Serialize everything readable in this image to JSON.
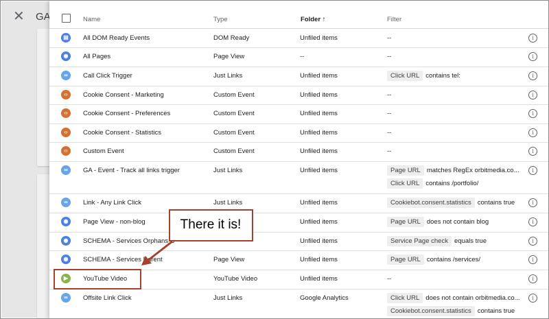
{
  "background": {
    "close_glyph": "✕",
    "title_fragment": "GA"
  },
  "table": {
    "headers": {
      "name": "Name",
      "type": "Type",
      "folder": "Folder",
      "sort_glyph": "↑",
      "filter": "Filter"
    },
    "info_glyph": "i",
    "rows": [
      {
        "name": "All DOM Ready Events",
        "type": "DOM Ready",
        "folder": "Unfiled items",
        "icon": "dom-ready-icon",
        "color": "#4a80e6",
        "glyph": "▤",
        "filters": [],
        "filter_text": "--"
      },
      {
        "name": "All Pages",
        "type": "Page View",
        "folder": "--",
        "icon": "eye-icon",
        "color": "#4a80e6",
        "glyph": "◉",
        "filters": [],
        "filter_text": "--"
      },
      {
        "name": "Call Click Trigger",
        "type": "Just Links",
        "folder": "Unfiled items",
        "icon": "link-icon",
        "color": "#66a5e8",
        "glyph": "∞",
        "filters": [
          {
            "chip": "Click URL",
            "rest": "contains tel:"
          }
        ]
      },
      {
        "name": "Cookie Consent - Marketing",
        "type": "Custom Event",
        "folder": "Unfiled items",
        "icon": "custom-event-icon",
        "color": "#d67131",
        "glyph": "‹›",
        "filters": [],
        "filter_text": "--"
      },
      {
        "name": "Cookie Consent - Preferences",
        "type": "Custom Event",
        "folder": "Unfiled items",
        "icon": "custom-event-icon",
        "color": "#d67131",
        "glyph": "‹›",
        "filters": [],
        "filter_text": "--"
      },
      {
        "name": "Cookie Consent - Statistics",
        "type": "Custom Event",
        "folder": "Unfiled items",
        "icon": "custom-event-icon",
        "color": "#d67131",
        "glyph": "‹›",
        "filters": [],
        "filter_text": "--"
      },
      {
        "name": "Custom Event",
        "type": "Custom Event",
        "folder": "Unfiled items",
        "icon": "custom-event-icon",
        "color": "#d67131",
        "glyph": "‹›",
        "filters": [],
        "filter_text": "--"
      },
      {
        "name": "GA - Event - Track all links trigger",
        "type": "Just Links",
        "folder": "Unfiled items",
        "icon": "link-icon",
        "color": "#66a5e8",
        "glyph": "∞",
        "filters": [
          {
            "chip": "Page URL",
            "rest": "matches RegEx orbitmedia.co..."
          },
          {
            "chip": "Click URL",
            "rest": "contains /portfolio/"
          }
        ]
      },
      {
        "name": "Link - Any Link Click",
        "type": "Just Links",
        "folder": "Unfiled items",
        "icon": "link-icon",
        "color": "#66a5e8",
        "glyph": "∞",
        "filters": [
          {
            "chip": "Cookiebot.consent.statistics",
            "rest": "contains true"
          }
        ]
      },
      {
        "name": "Page View - non-blog",
        "type": "",
        "folder": "Unfiled items",
        "icon": "eye-icon",
        "color": "#4a80e6",
        "glyph": "◉",
        "filters": [
          {
            "chip": "Page URL",
            "rest": "does not contain blog"
          }
        ]
      },
      {
        "name": "SCHEMA - Services Orphans C",
        "type": "",
        "folder": "Unfiled items",
        "icon": "eye-icon",
        "color": "#4a80e6",
        "glyph": "◉",
        "filters": [
          {
            "chip": "Service Page check",
            "rest": "equals true"
          }
        ]
      },
      {
        "name": "SCHEMA - Services Parent",
        "type": "Page View",
        "folder": "Unfiled items",
        "icon": "eye-icon",
        "color": "#4a80e6",
        "glyph": "◉",
        "filters": [
          {
            "chip": "Page URL",
            "rest": "contains /services/"
          }
        ]
      },
      {
        "name": "YouTube Video",
        "type": "YouTube Video",
        "folder": "Unfiled items",
        "icon": "youtube-video-icon",
        "color": "#8bb34a",
        "glyph": "▶",
        "filters": [],
        "filter_text": "--"
      },
      {
        "name": "Offsite Link Click",
        "type": "Just Links",
        "folder": "Google Analytics",
        "icon": "link-icon",
        "color": "#66a5e8",
        "glyph": "∞",
        "filters": [
          {
            "chip": "Click URL",
            "rest": "does not contain orbitmedia.co..."
          },
          {
            "chip": "Cookiebot.consent.statistics",
            "rest": "contains true"
          }
        ]
      }
    ]
  },
  "annotation": {
    "callout_text": "There it is!",
    "accent_color": "#a6402c"
  }
}
